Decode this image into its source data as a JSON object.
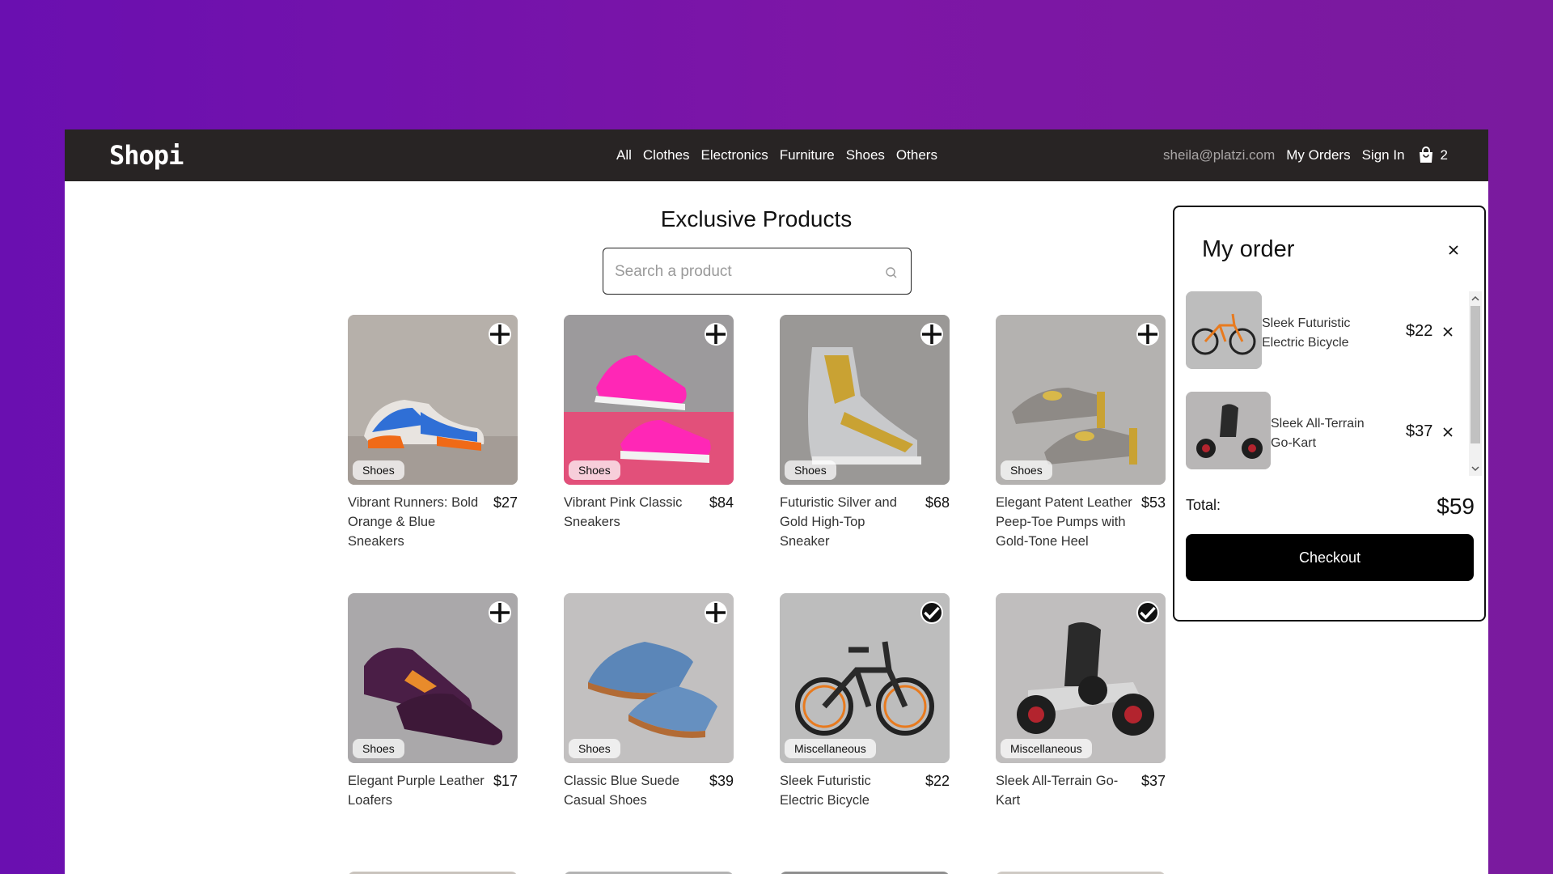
{
  "navbar": {
    "brand": "Shopi",
    "categories": [
      "All",
      "Clothes",
      "Electronics",
      "Furniture",
      "Shoes",
      "Others"
    ],
    "email": "sheila@platzi.com",
    "my_orders": "My Orders",
    "sign_in": "Sign In",
    "cart_count": "2"
  },
  "main": {
    "title": "Exclusive Products",
    "search_placeholder": "Search a product"
  },
  "products": [
    {
      "name": "Vibrant Runners: Bold Orange & Blue Sneakers",
      "price": "$27",
      "category": "Shoes",
      "in_cart": false
    },
    {
      "name": "Vibrant Pink Classic Sneakers",
      "price": "$84",
      "category": "Shoes",
      "in_cart": false
    },
    {
      "name": "Futuristic Silver and Gold High-Top Sneaker",
      "price": "$68",
      "category": "Shoes",
      "in_cart": false
    },
    {
      "name": "Elegant Patent Leather Peep-Toe Pumps with Gold-Tone Heel",
      "price": "$53",
      "category": "Shoes",
      "in_cart": false
    },
    {
      "name": "Elegant Purple Leather Loafers",
      "price": "$17",
      "category": "Shoes",
      "in_cart": false
    },
    {
      "name": "Classic Blue Suede Casual Shoes",
      "price": "$39",
      "category": "Shoes",
      "in_cart": false
    },
    {
      "name": "Sleek Futuristic Electric Bicycle",
      "price": "$22",
      "category": "Miscellaneous",
      "in_cart": true
    },
    {
      "name": "Sleek All-Terrain Go-Kart",
      "price": "$37",
      "category": "Miscellaneous",
      "in_cart": true
    }
  ],
  "order": {
    "title": "My order",
    "items": [
      {
        "name": "Sleek Futuristic Electric Bicycle",
        "price": "$22"
      },
      {
        "name": "Sleek All-Terrain Go-Kart",
        "price": "$37"
      }
    ],
    "total_label": "Total:",
    "total_value": "$59",
    "checkout_label": "Checkout"
  },
  "colors": {
    "background_start": "#6a0fb0",
    "background_end": "#7a1a9e",
    "navbar": "#282424",
    "checkout": "#000000"
  }
}
